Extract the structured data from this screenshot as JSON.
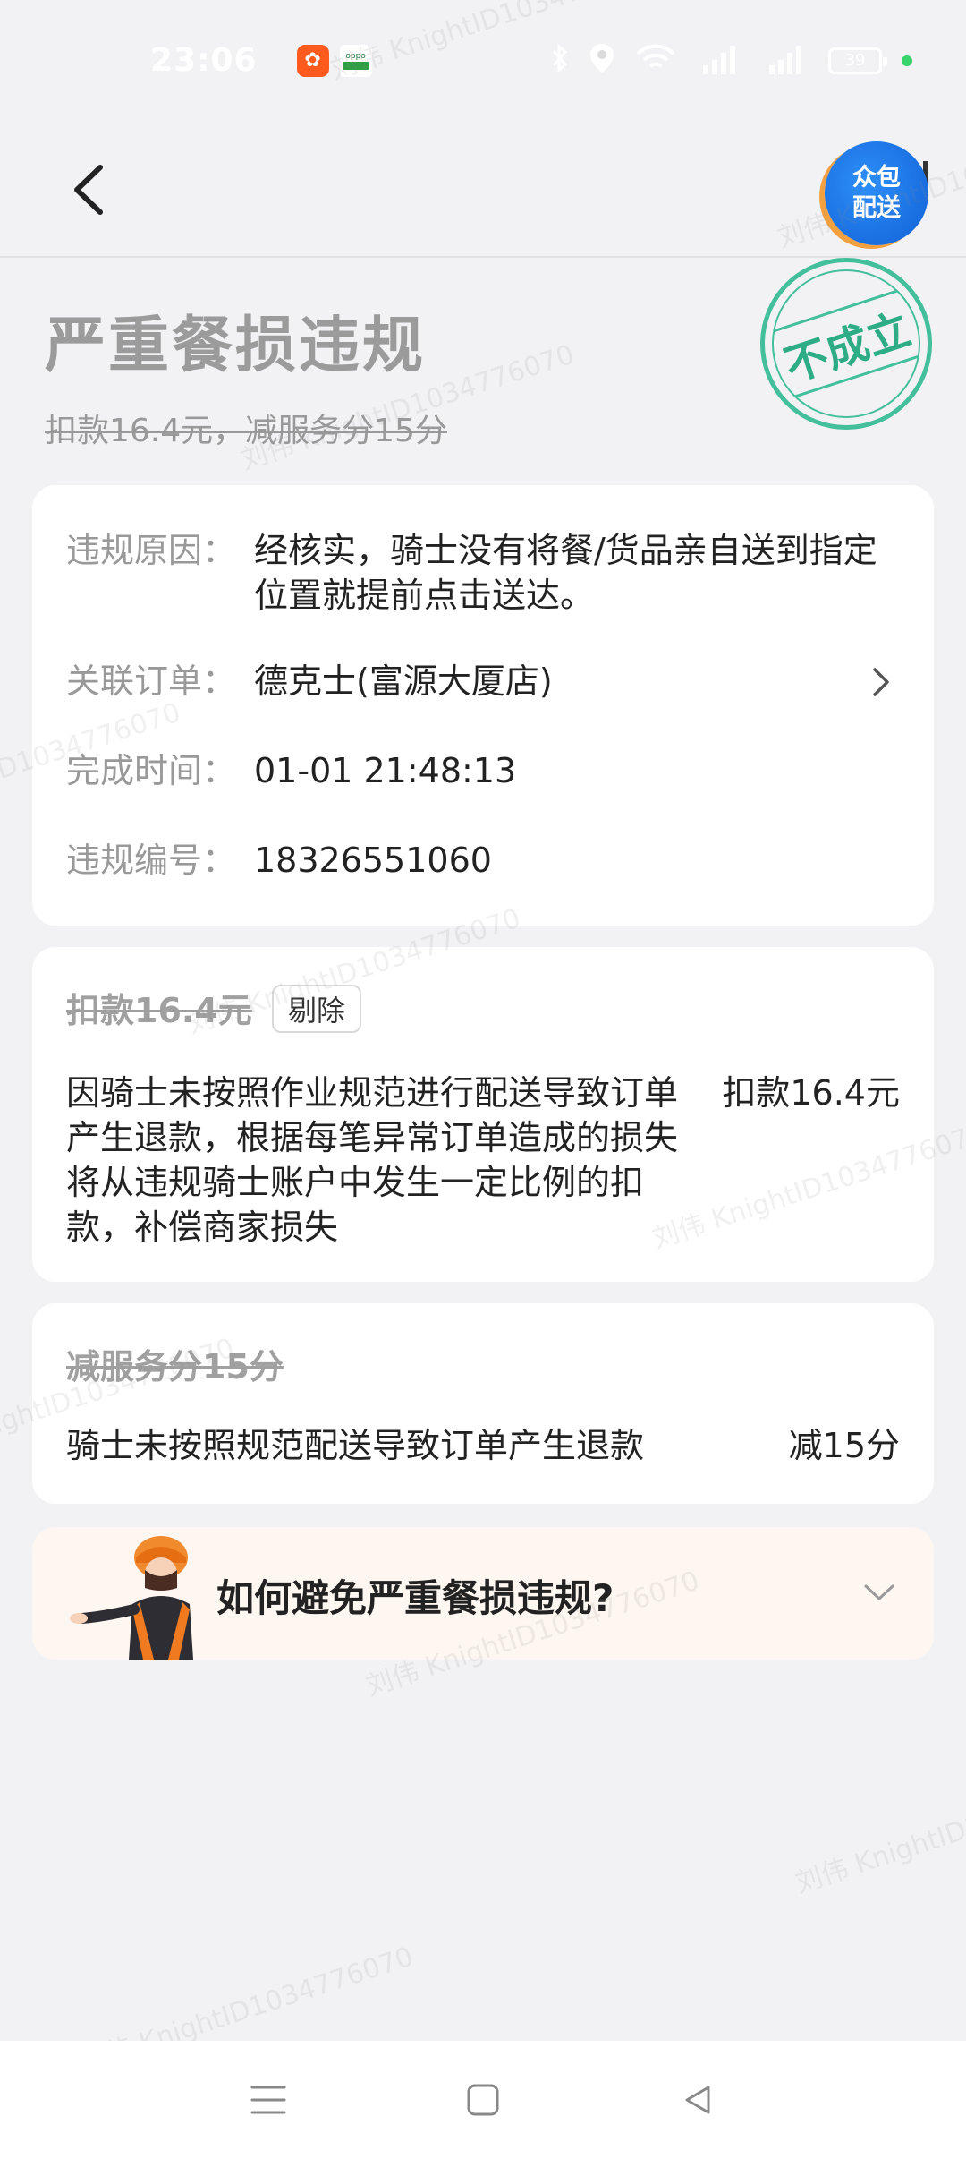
{
  "status_bar": {
    "time": "23:06",
    "battery": "39"
  },
  "header": {
    "right_badge_line1": "众包",
    "right_badge_line2": "配送"
  },
  "title": "严重餐损违规",
  "penalty_summary": "扣款16.4元，减服务分15分",
  "stamp_text": "不成立",
  "info_card": {
    "rows": [
      {
        "label": "违规原因：",
        "value": "经核实，骑士没有将餐/货品亲自送到指定位置就提前点击送达。"
      },
      {
        "label": "关联订单：",
        "value": "德克士(富源大厦店)"
      },
      {
        "label": "完成时间：",
        "value": "01-01 21:48:13"
      },
      {
        "label": "违规编号：",
        "value": "18326551060"
      }
    ]
  },
  "deduction_card": {
    "title": "扣款16.4元",
    "tag": "剔除",
    "description": "因骑士未按照作业规范进行配送导致订单产生退款，根据每笔异常订单造成的损失将从违规骑士账户中发生一定比例的扣款，补偿商家损失",
    "amount": "扣款16.4元"
  },
  "score_card": {
    "title": "减服务分15分",
    "reason": "骑士未按照规范配送导致订单产生退款",
    "amount": "减15分"
  },
  "tip_card": {
    "title": "如何避免严重餐损违规?"
  },
  "watermark_text": "刘伟 KnightID1034776070",
  "colors": {
    "stamp": "#43bf9c",
    "badge": "#1a73e8",
    "background": "#f2f2f4"
  }
}
